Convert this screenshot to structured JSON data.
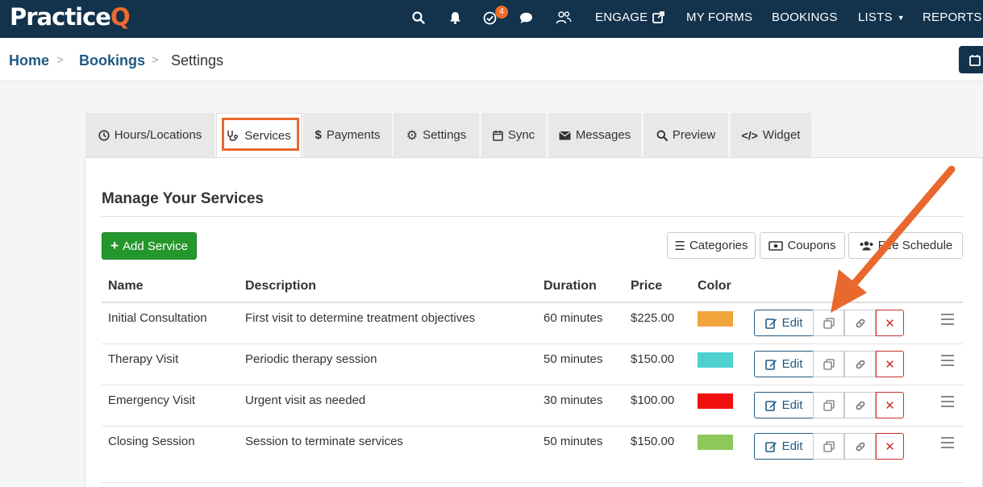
{
  "app": {
    "logo_main": "Practice",
    "logo_accent": "Q"
  },
  "topnav": {
    "notification_count": "4",
    "links": [
      "ENGAGE",
      "MY FORMS",
      "BOOKINGS",
      "LISTS",
      "REPORTS"
    ]
  },
  "breadcrumb": {
    "home": "Home",
    "bookings": "Bookings",
    "current": "Settings",
    "separator": ">"
  },
  "tabs": [
    {
      "label": "Hours/Locations",
      "icon": "clock-icon"
    },
    {
      "label": "Services",
      "icon": "stethoscope-icon"
    },
    {
      "label": "Payments",
      "icon": "dollar-icon"
    },
    {
      "label": "Settings",
      "icon": "gear-icon"
    },
    {
      "label": "Sync",
      "icon": "calendar-icon"
    },
    {
      "label": "Messages",
      "icon": "envelope-icon"
    },
    {
      "label": "Preview",
      "icon": "search-icon"
    },
    {
      "label": "Widget",
      "icon": "code-icon"
    }
  ],
  "panel": {
    "title": "Manage Your Services",
    "add_button": "Add Service",
    "categories_button": "Categories",
    "coupons_button": "Coupons",
    "fee_schedule_button": "Fee Schedule"
  },
  "table": {
    "headers": [
      "Name",
      "Description",
      "Duration",
      "Price",
      "Color"
    ],
    "edit_label": "Edit",
    "rows": [
      {
        "name": "Initial Consultation",
        "description": "First visit to determine treatment objectives",
        "duration": "60 minutes",
        "price": "$225.00",
        "color": "#f0a43c"
      },
      {
        "name": "Therapy Visit",
        "description": "Periodic therapy session",
        "duration": "50 minutes",
        "price": "$150.00",
        "color": "#4dd0d0"
      },
      {
        "name": "Emergency Visit",
        "description": "Urgent visit as needed",
        "duration": "30 minutes",
        "price": "$100.00",
        "color": "#f01010"
      },
      {
        "name": "Closing Session",
        "description": "Session to terminate services",
        "duration": "50 minutes",
        "price": "$150.00",
        "color": "#8fc85a"
      }
    ]
  },
  "colors": {
    "nav_bg": "#13324c",
    "accent": "#ef6c2c",
    "link": "#1f5a84",
    "add_green": "#24972c",
    "delete_red": "#c9302c"
  }
}
